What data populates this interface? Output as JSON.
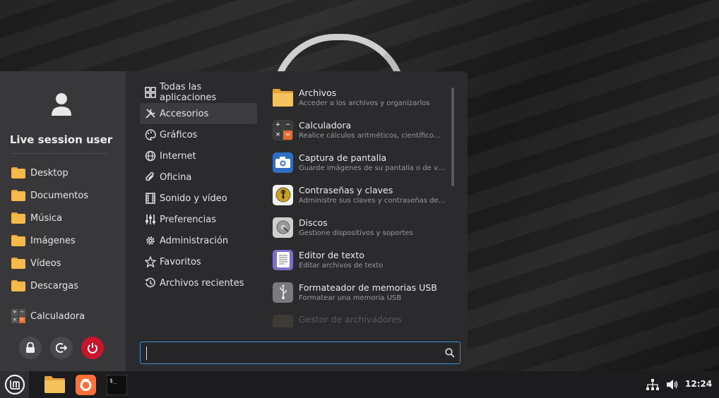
{
  "user": {
    "name": "Live session user"
  },
  "places": [
    {
      "label": "Desktop"
    },
    {
      "label": "Documentos"
    },
    {
      "label": "Música"
    },
    {
      "label": "Imágenes"
    },
    {
      "label": "Vídeos"
    },
    {
      "label": "Descargas"
    }
  ],
  "favorites": [
    {
      "label": "Calculadora"
    }
  ],
  "session_buttons": {
    "lock": "lock-icon",
    "logout": "logout-icon",
    "power": "power-icon"
  },
  "categories": [
    {
      "label": "Todas las aplicaciones",
      "icon": "grid-icon"
    },
    {
      "label": "Accesorios",
      "icon": "tools-icon",
      "active": true
    },
    {
      "label": "Gráficos",
      "icon": "palette-icon"
    },
    {
      "label": "Internet",
      "icon": "globe-icon"
    },
    {
      "label": "Oficina",
      "icon": "paperclip-icon"
    },
    {
      "label": "Sonido y vídeo",
      "icon": "film-icon"
    },
    {
      "label": "Preferencias",
      "icon": "sliders-icon"
    },
    {
      "label": "Administración",
      "icon": "gear-icon"
    },
    {
      "label": "Favoritos",
      "icon": "star-icon"
    },
    {
      "label": "Archivos recientes",
      "icon": "history-icon"
    }
  ],
  "apps": [
    {
      "name": "Archivos",
      "desc": "Acceder a los archivos y organizarlos",
      "icon": "folder-icon"
    },
    {
      "name": "Calculadora",
      "desc": "Realice cálculos aritméticos, científico…",
      "icon": "calculator-icon"
    },
    {
      "name": "Captura de pantalla",
      "desc": "Guarde imágenes de su pantalla o de v…",
      "icon": "camera-icon"
    },
    {
      "name": "Contraseñas y claves",
      "desc": "Administre sus claves y contraseñas de…",
      "icon": "keyring-icon"
    },
    {
      "name": "Discos",
      "desc": "Gestione dispositivos y soportes",
      "icon": "disk-icon"
    },
    {
      "name": "Editor de texto",
      "desc": "Editar archivos de texto",
      "icon": "text-editor-icon"
    },
    {
      "name": "Formateador de memorias USB",
      "desc": "Formatear una memoria USB",
      "icon": "usb-icon"
    },
    {
      "name": "Gestor de archivadores",
      "desc": "",
      "icon": "archive-icon"
    }
  ],
  "search": {
    "value": "",
    "placeholder": ""
  },
  "panel": {
    "launchers": [
      "files-icon",
      "firefox-icon",
      "terminal-icon"
    ],
    "clock": "12:24"
  },
  "colors": {
    "accent": "#3d8fd1",
    "power": "#c7162b",
    "folder": "#f6b94c",
    "firefox": "#ff7139"
  }
}
